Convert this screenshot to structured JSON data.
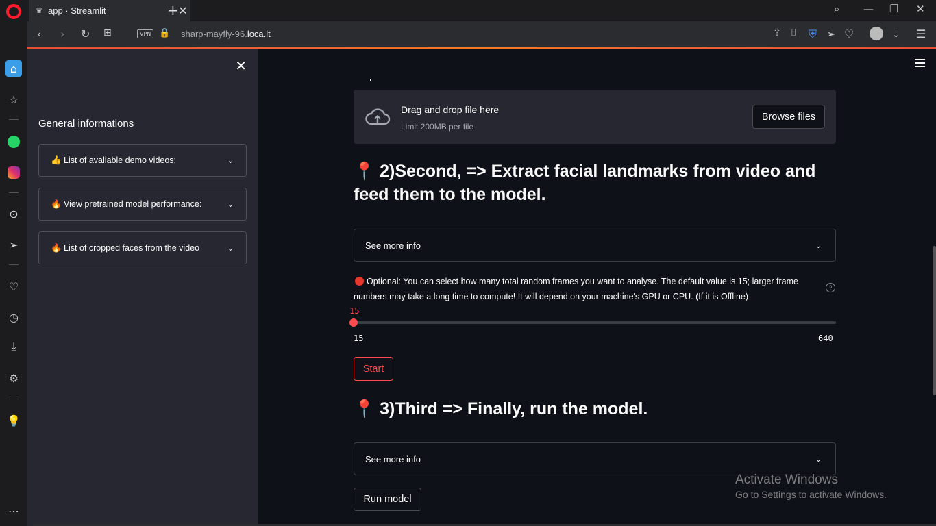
{
  "browser": {
    "tab_title": "app · Streamlit",
    "url_prefix": "sharp-mayfly-96.",
    "url_domain": "loca.lt",
    "vpn_label": "VPN"
  },
  "sidebar": {
    "heading": "General informations",
    "expanders": [
      {
        "label": "👍 List of avaliable demo videos:"
      },
      {
        "label": "🔥 View pretrained model performance:"
      },
      {
        "label": "🔥 List of cropped faces from the video"
      }
    ]
  },
  "uploader": {
    "main_text": "Drag and drop file here",
    "sub_text": "Limit 200MB per file",
    "button_label": "Browse files"
  },
  "section2": {
    "icon": "📍",
    "title": "2)Second, => Extract facial landmarks from video and feed them to the model."
  },
  "expander2": {
    "label": "See more info"
  },
  "optional_text": "Optional: You can select how many total random frames you want to analyse. The default value is 15; larger frame numbers may take a long time to compute! It will depend on your machine's GPU or CPU. (If it is Offline)",
  "slider": {
    "value": "15",
    "min": "15",
    "max": "640",
    "fraction": 0
  },
  "start_button": "Start",
  "section3": {
    "icon": "📍",
    "title": "3)Third => Finally, run the model."
  },
  "expander3": {
    "label": "See more info"
  },
  "run_button": "Run model",
  "watermark": {
    "line1": "Activate Windows",
    "line2": "Go to Settings to activate Windows."
  }
}
